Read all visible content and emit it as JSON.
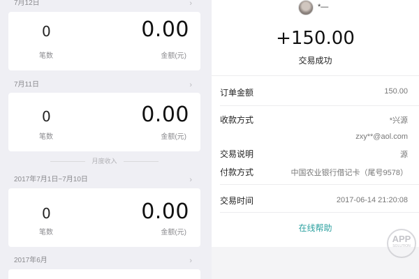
{
  "left": {
    "sections": [
      {
        "header": "7月12日",
        "count": "0",
        "count_label": "笔数",
        "amount": "0.00",
        "amount_label": "金额(元)"
      },
      {
        "header": "7月11日",
        "count": "0",
        "count_label": "笔数",
        "amount": "0.00",
        "amount_label": "金额(元)"
      },
      {
        "header": "2017年7月1日~7月10日",
        "count": "0",
        "count_label": "笔数",
        "amount": "0.00",
        "amount_label": "金额(元)"
      },
      {
        "header": "2017年6月"
      }
    ],
    "divider_label": "月度收入"
  },
  "detail": {
    "payee_name": "*—",
    "amount": "+150.00",
    "status": "交易成功",
    "rows": [
      {
        "label": "订单金额",
        "value": "150.00"
      },
      {
        "label": "收款方式",
        "value": "*兴源",
        "value2": "zxy**@aol.com"
      },
      {
        "label": "交易说明",
        "value": "源"
      },
      {
        "label": "付款方式",
        "value": "中国农业银行借记卡（尾号9578）"
      },
      {
        "label": "交易时间",
        "value": "2017-06-14 21:20:08"
      }
    ],
    "help_link": "在线帮助"
  },
  "watermark": {
    "main": "APP",
    "sub": "SOLUTION"
  }
}
